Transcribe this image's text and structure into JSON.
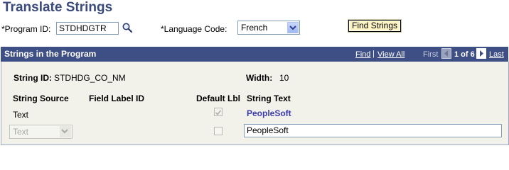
{
  "page": {
    "title": "Translate Strings"
  },
  "search": {
    "program_id_label": "*Program ID:",
    "program_id_value": "STDHDGTR",
    "language_label": "*Language Code:",
    "language_value": "French",
    "find_button": "Find Strings"
  },
  "grid": {
    "title": "Strings in the Program",
    "find_link": "Find",
    "separator": "|",
    "view_all_link": "View All",
    "first_label": "First",
    "position": "1 of 6",
    "last_link": "Last",
    "row": {
      "string_id_label": "String ID:",
      "string_id_value": "STDHDG_CO_NM",
      "width_label": "Width:",
      "width_value": "10",
      "col_string_source": "String Source",
      "col_field_label_id": "Field Label ID",
      "col_default_lbl": "Default Lbl",
      "col_string_text": "String Text",
      "base_source": "Text",
      "base_text": "PeopleSoft",
      "translated_source": "Text",
      "translated_text": "PeopleSoft",
      "base_default_checked": true,
      "translated_default_checked": false
    }
  }
}
